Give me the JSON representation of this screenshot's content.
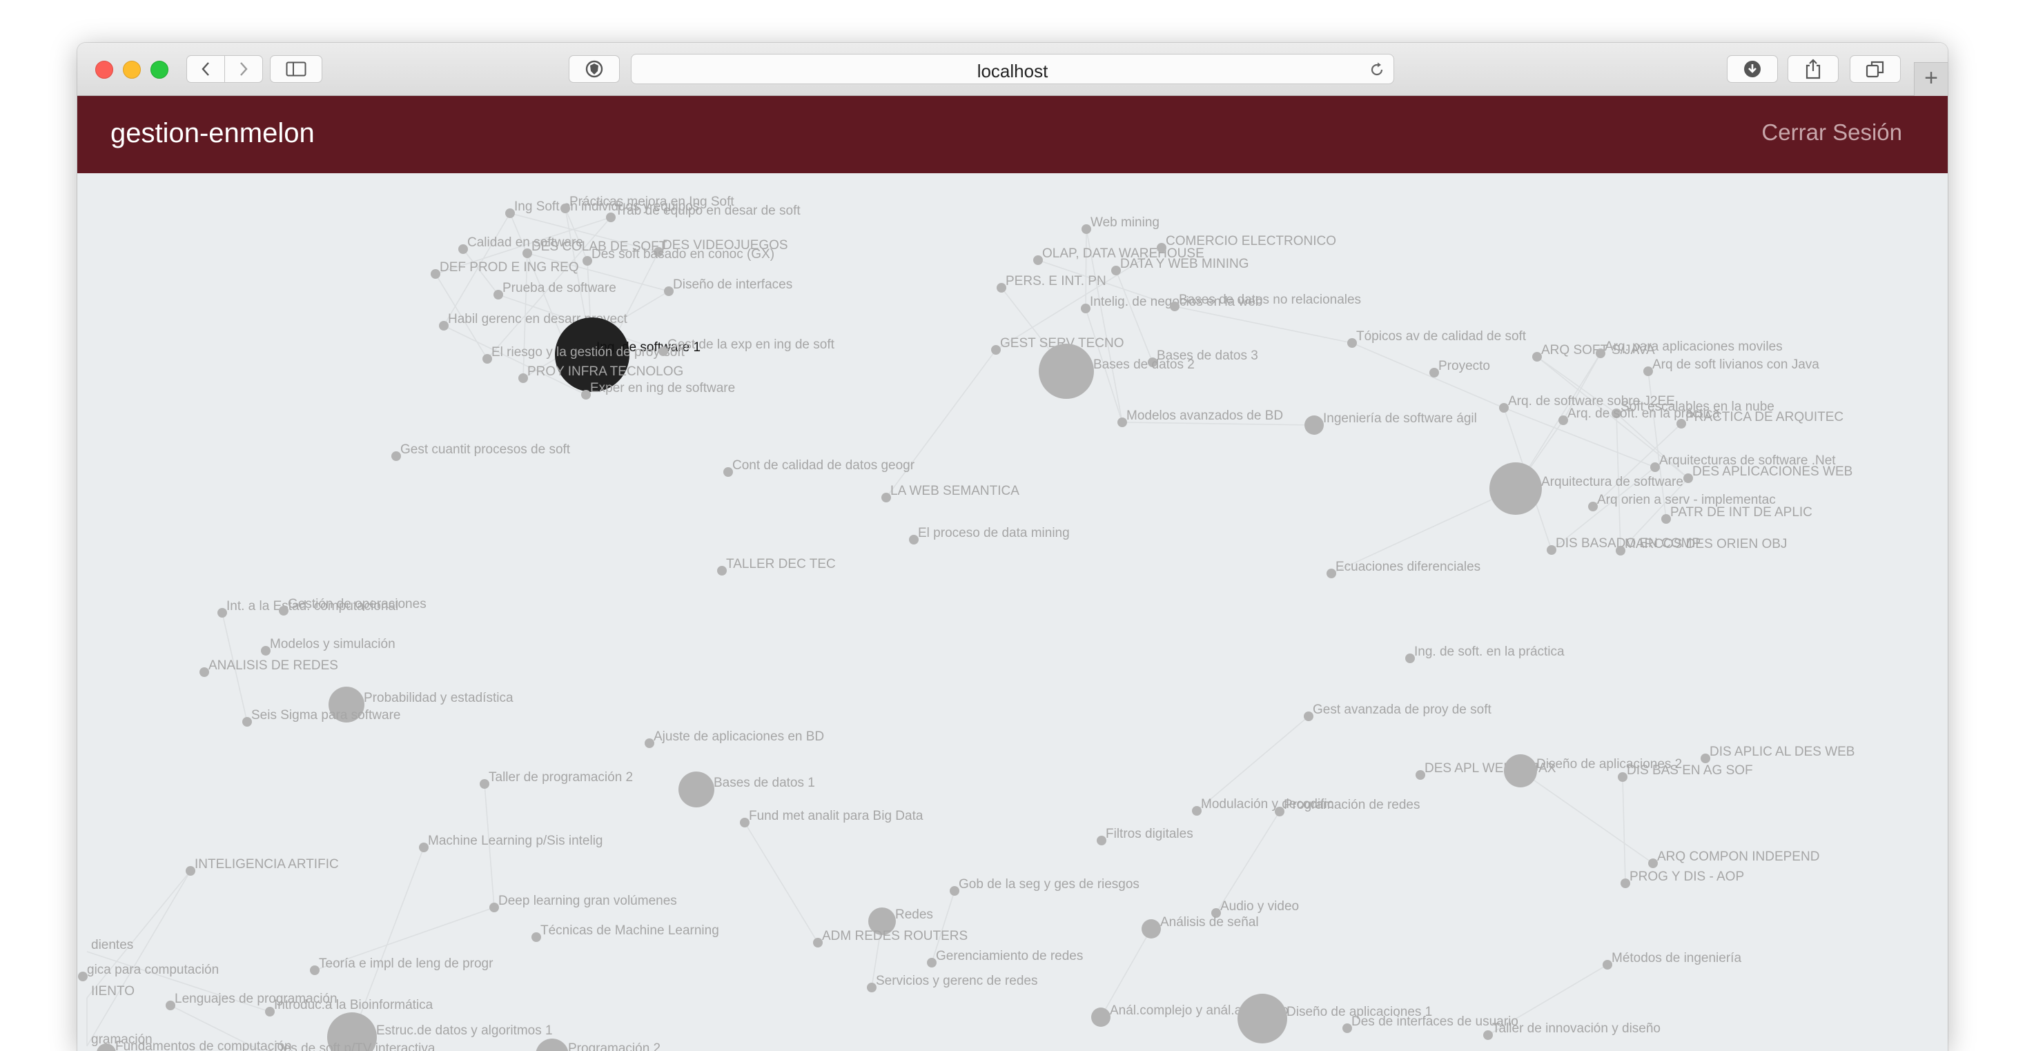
{
  "browser": {
    "url": "localhost",
    "icons": [
      "back-icon",
      "forward-icon",
      "sidebar-icon",
      "privacy-shield-icon",
      "reload-icon",
      "download-icon",
      "share-icon",
      "tabs-icon",
      "new-tab-icon"
    ]
  },
  "app": {
    "title": "gestion-enmelon",
    "logout_label": "Cerrar Sesión",
    "colors": {
      "header": "#601922",
      "canvas": "#eaedef",
      "node": "#b3b3b3",
      "active_node": "#222222"
    }
  },
  "graph": {
    "nodes": [
      {
        "label": "Ing Soft en individuos y equipos"
      },
      {
        "label": "Prácticas mejora en Ing Soft"
      },
      {
        "label": "Trab de equipo en desar de soft"
      },
      {
        "label": "Calidad en software"
      },
      {
        "label": "DES COLAB DE SOFT"
      },
      {
        "label": "DES VIDEOJUEGOS"
      },
      {
        "label": "Des soft basado en conoc (GX)"
      },
      {
        "label": "DEF PROD E ING REQ"
      },
      {
        "label": "Prueba de software"
      },
      {
        "label": "Diseño de interfaces"
      },
      {
        "label": "Habil gerenc en desarr proyect"
      },
      {
        "label": "Ing. de software 1",
        "active": true
      },
      {
        "label": "El riesgo y la gestión de proy soft"
      },
      {
        "label": "Gest de la exp en ing de soft"
      },
      {
        "label": "PROY INFRA TECNOLOG"
      },
      {
        "label": "Exper en ing de software"
      },
      {
        "label": "Gest cuantit procesos de soft"
      },
      {
        "label": "Cont de calidad de datos geogr"
      },
      {
        "label": "LA WEB SEMANTICA"
      },
      {
        "label": "El proceso de data mining"
      },
      {
        "label": "TALLER DEC TEC"
      },
      {
        "label": "Int. a la Estad. computacional"
      },
      {
        "label": "Gestión de operaciones"
      },
      {
        "label": "Modelos y simulación"
      },
      {
        "label": "ANALISIS DE REDES"
      },
      {
        "label": "Probabilidad y estadística"
      },
      {
        "label": "Seis Sigma para software"
      },
      {
        "label": "Ajuste de aplicaciones en BD"
      },
      {
        "label": "Taller de programación 2"
      },
      {
        "label": "Bases de datos 1"
      },
      {
        "label": "Fund met analit para Big Data"
      },
      {
        "label": "Machine Learning p/Sis intelig"
      },
      {
        "label": "INTELIGENCIA ARTIFIC"
      },
      {
        "label": "Deep learning gran volúmenes"
      },
      {
        "label": "Técnicas de Machine Learning"
      },
      {
        "label": "dientes"
      },
      {
        "label": "gica para computación"
      },
      {
        "label": "IIENTO"
      },
      {
        "label": "Teoría e impl de leng de progr"
      },
      {
        "label": "Lenguajes de programación"
      },
      {
        "label": "Introduc.a la Bioinformática"
      },
      {
        "label": "Estruc.de datos y algoritmos 1"
      },
      {
        "label": "gramación"
      },
      {
        "label": "Fundamentos de computación"
      },
      {
        "label": "Des de soft p/TV interactiva"
      },
      {
        "label": "Programación 2"
      },
      {
        "label": "Web mining"
      },
      {
        "label": "OLAP, DATA WAREHOUSE"
      },
      {
        "label": "COMERCIO ELECTRONICO"
      },
      {
        "label": "DATA Y WEB MINING"
      },
      {
        "label": "PERS. E INT. PN"
      },
      {
        "label": "Intelig. de negocios en la web"
      },
      {
        "label": "Bases de datos no relacionales"
      },
      {
        "label": "GEST SERV TECNO"
      },
      {
        "label": "Bases de datos 3"
      },
      {
        "label": "Bases de datos 2"
      },
      {
        "label": "Modelos avanzados de BD"
      },
      {
        "label": "Tópicos av de calidad de soft"
      },
      {
        "label": "ARQ SOFT S/JAVA"
      },
      {
        "label": "Arq. para aplicaciones moviles"
      },
      {
        "label": "Proyecto"
      },
      {
        "label": "Arq de soft livianos con Java"
      },
      {
        "label": "Arq. de software sobre J2EE"
      },
      {
        "label": "Soft escalables en la nube"
      },
      {
        "label": "Arq. de soft. en la práctica"
      },
      {
        "label": "PRACTICA DE ARQUITEC"
      },
      {
        "label": "Ingeniería de software ágil"
      },
      {
        "label": "Arquitecturas de software .Net"
      },
      {
        "label": "DES APLICACIONES WEB"
      },
      {
        "label": "Arquitectura de software"
      },
      {
        "label": "Arq orien a serv - implementac"
      },
      {
        "label": "PATR DE INT DE APLIC"
      },
      {
        "label": "DIS BASADO EN COMP"
      },
      {
        "label": "MARCOS DES ORIEN OBJ"
      },
      {
        "label": "Ecuaciones diferenciales"
      },
      {
        "label": "Ing. de soft. en la práctica"
      },
      {
        "label": "Gest avanzada de proy de soft"
      },
      {
        "label": "DIS APLIC AL DES WEB"
      },
      {
        "label": "DES APL WEB - AJAX"
      },
      {
        "label": "Diseño de aplicaciones 2"
      },
      {
        "label": "DIS BAS EN AG SOF"
      },
      {
        "label": "Modulación y decodific."
      },
      {
        "label": "Programación de redes"
      },
      {
        "label": "Filtros digitales"
      },
      {
        "label": "ARQ COMPON INDEPEND"
      },
      {
        "label": "PROG Y DIS - AOP"
      },
      {
        "label": "Gob de la seg y ges de riesgos"
      },
      {
        "label": "Audio y video"
      },
      {
        "label": "Redes"
      },
      {
        "label": "Análisis de señal"
      },
      {
        "label": "ADM REDES ROUTERS"
      },
      {
        "label": "Gerenciamiento de redes"
      },
      {
        "label": "Métodos de ingeniería"
      },
      {
        "label": "Servicios y gerenc de redes"
      },
      {
        "label": "Anál.complejo y anál.armónico"
      },
      {
        "label": "Diseño de aplicaciones 1"
      },
      {
        "label": "Des de interfaces de usuario"
      },
      {
        "label": "Taller de innovación y diseño"
      }
    ]
  }
}
